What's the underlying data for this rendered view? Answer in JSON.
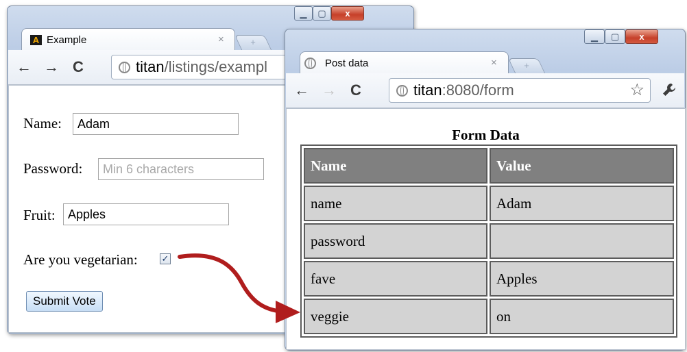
{
  "left_window": {
    "tab_title": "Example",
    "tab_close": "×",
    "new_tab": "+",
    "caption": {
      "minimize": "▁",
      "maximize": "▢",
      "close": "x"
    },
    "address_host": "titan",
    "address_path": "/listings/exampl",
    "form": {
      "name_label": "Name:",
      "name_value": "Adam",
      "password_label": "Password:",
      "password_placeholder": "Min 6 characters",
      "fruit_label": "Fruit:",
      "fruit_value": "Apples",
      "veg_label": "Are you vegetarian:",
      "veg_checked": "✓",
      "submit_label": "Submit Vote"
    }
  },
  "right_window": {
    "tab_title": "Post data",
    "tab_close": "×",
    "new_tab": "+",
    "caption": {
      "minimize": "▁",
      "maximize": "▢",
      "close": "x"
    },
    "address_host": "titan",
    "address_path": ":8080/form",
    "star": "☆",
    "wrench": "🔧",
    "table_caption": "Form Data",
    "table": {
      "headers": [
        "Name",
        "Value"
      ],
      "rows": [
        [
          "name",
          "Adam"
        ],
        [
          "password",
          ""
        ],
        [
          "fave",
          "Apples"
        ],
        [
          "veggie",
          "on"
        ]
      ]
    }
  },
  "colors": {
    "arrow": "#b01d1d",
    "header_bg": "#808080",
    "cell_bg": "#d3d3d3"
  },
  "icons": [
    "back-icon",
    "forward-icon",
    "reload-icon",
    "globe-icon",
    "star-icon",
    "wrench-icon",
    "favicon-icon",
    "curved-arrow-icon"
  ]
}
